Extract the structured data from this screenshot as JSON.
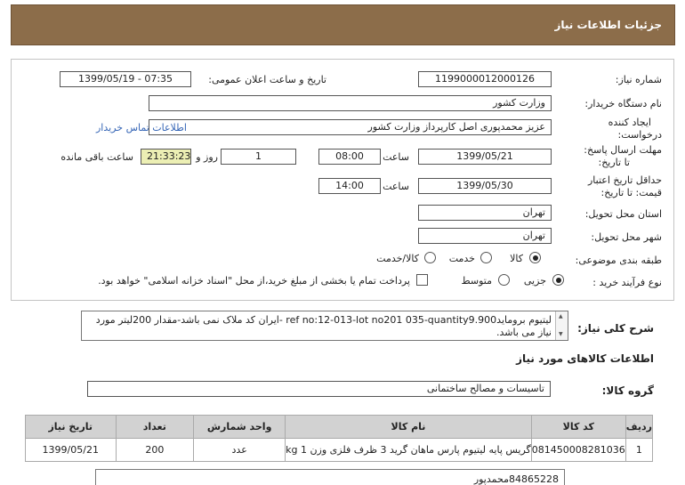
{
  "header": {
    "title": "جزئیات اطلاعات نیاز"
  },
  "form": {
    "need_number_label": "شماره نیاز:",
    "need_number": "1199000012000126",
    "announce_label": "تاریخ و ساعت اعلان عمومی:",
    "announce_value": "1399/05/19 - 07:35",
    "buyer_org_label": "نام دستگاه خریدار:",
    "buyer_org": "وزارت کشور",
    "requester_label_1": "ایجاد کننده",
    "requester_label_2": "درخواست:",
    "requester": "عزیز محمدپوری اصل کارپرداز وزارت کشور",
    "contact_link": "اطلاعات تماس خریدار",
    "deadline_label_1": "مهلت ارسال پاسخ:",
    "deadline_label_2": "تا تاریخ:",
    "deadline_date": "1399/05/21",
    "time_label": "ساعت",
    "deadline_time": "08:00",
    "days_value": "1",
    "days_label": "روز و",
    "remaining_timer": "21:33:23",
    "remaining_label": "ساعت باقی مانده",
    "validity_label_1": "حداقل تاریخ اعتبار",
    "validity_label_2": "قیمت: تا تاریخ:",
    "validity_date": "1399/05/30",
    "validity_time_label": "ساعت",
    "validity_time": "14:00",
    "province_label": "استان محل تحویل:",
    "province": "تهران",
    "city_label": "شهر محل تحویل:",
    "city": "تهران",
    "category_label": "طبقه بندی موضوعی:",
    "category_options": [
      "کالا",
      "خدمت",
      "کالا/خدمت"
    ],
    "category_selected": "کالا",
    "process_label": "نوع فرآیند خرید :",
    "process_options": [
      "جزیی",
      "متوسط"
    ],
    "process_selected": "جزیی",
    "payment_note": "پرداخت تمام یا بخشی از مبلغ خرید،از محل \"اسناد خزانه اسلامی\" خواهد بود."
  },
  "description": {
    "label": "شرح کلی نیاز:",
    "text": "لیتیوم برومایدref no:12-013-lot no201 035-quantity9.900 -ایران کد ملاک نمی باشد-مقدار 200لیتر مورد نیاز می باشد."
  },
  "goods": {
    "section_title": "اطلاعات کالاهای مورد نیاز",
    "group_label": "گروه کالا:",
    "group_value": "تاسیسات و مصالح ساختمانی",
    "columns": [
      "ردیف",
      "کد کالا",
      "نام کالا",
      "واحد شمارش",
      "تعداد",
      "تاریخ نیاز"
    ],
    "rows": [
      [
        "1",
        "081450008281036",
        "گریس پایه لیتیوم پارس ماهان گرید 3 ظرف فلزی وزن 1 kg",
        "عدد",
        "200",
        "1399/05/21"
      ]
    ]
  },
  "bottom": {
    "text": "84865228محمدپور"
  }
}
